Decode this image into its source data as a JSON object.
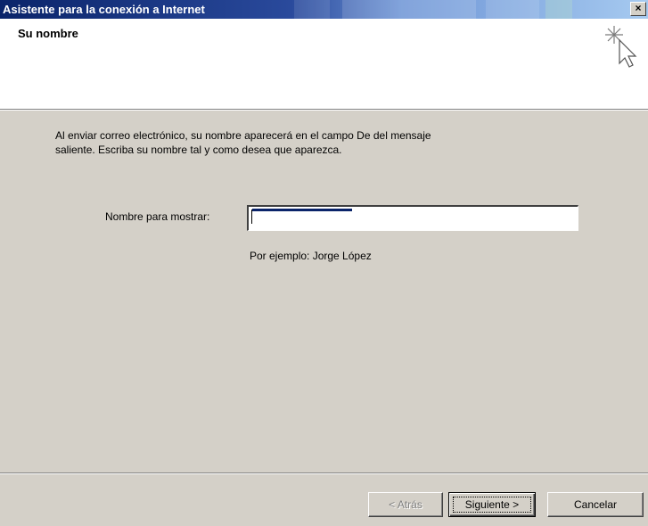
{
  "window": {
    "title": "Asistente para la conexión a Internet",
    "close_glyph": "×"
  },
  "header": {
    "title": "Su nombre",
    "icon": "wizard-cursor-icon"
  },
  "body": {
    "intro_line1": "Al enviar correo electrónico, su nombre aparecerá en el campo De del mensaje",
    "intro_line2": "saliente. Escriba su nombre tal y como desea que aparezca.",
    "field_label": "Nombre para mostrar:",
    "display_name_value": "",
    "example": "Por ejemplo: Jorge López"
  },
  "buttons": {
    "back": "< Atrás",
    "next": "Siguiente >",
    "cancel": "Cancelar"
  },
  "colors": {
    "titlebar_start": "#0a246a",
    "titlebar_end": "#a6caf0",
    "dialog_face": "#d4d0c8",
    "header_bg": "#ffffff"
  }
}
